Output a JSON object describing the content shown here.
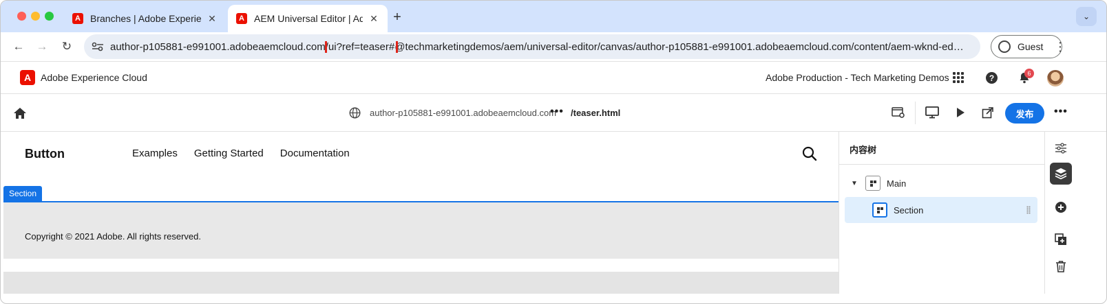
{
  "browser": {
    "tabs": [
      {
        "label": "Branches | Adobe Experience",
        "active": false
      },
      {
        "label": "AEM Universal Editor | Adobe",
        "active": true
      }
    ],
    "new_tab": "+",
    "url": {
      "before": "author-p105881-e991001.adobeaemcloud.com/",
      "highlighted": "ui?ref=teaser#",
      "after": "@techmarketingdemos/aem/universal-editor/canvas/author-p105881-e991001.adobeaemcloud.com/content/aem-wknd-eds-ue/b..."
    },
    "profile_label": "Guest",
    "highlight_color": "#e0241a"
  },
  "shell": {
    "app_title": "Adobe Experience Cloud",
    "org": "Adobe Production - Tech Marketing Demos",
    "notifications_count": "6",
    "help_glyph": "?",
    "logo_glyph": "A"
  },
  "editor": {
    "host": "author-p105881-e991001.adobeaemcloud.com",
    "ellipsis": "•••",
    "path": "/teaser.html",
    "publish_label": "发布",
    "more": "•••",
    "accent": "#1473e6"
  },
  "canvas": {
    "brand": "Button",
    "nav": [
      "Examples",
      "Getting Started",
      "Documentation"
    ],
    "section_tag": "Section",
    "copyright": "Copyright © 2021 Adobe. All rights reserved."
  },
  "panel": {
    "title": "内容树",
    "tree": [
      {
        "label": "Main",
        "expanded": true
      },
      {
        "label": "Section",
        "selected": true
      }
    ]
  },
  "rail": {
    "icons": [
      "properties-icon",
      "content-tree-icon",
      "add-icon",
      "duplicate-icon",
      "delete-icon"
    ]
  }
}
